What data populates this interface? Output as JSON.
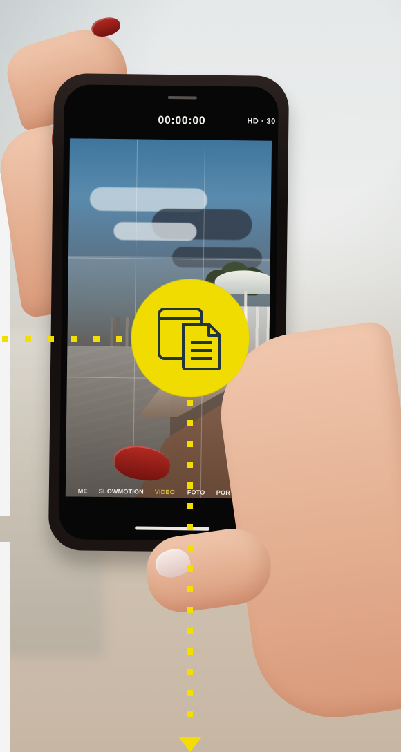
{
  "camera": {
    "timer": "00:00:00",
    "quality": "HD · 30",
    "modes": [
      "ME",
      "SLOWMOTION",
      "VIDEO",
      "FOTO",
      "PORTRET"
    ],
    "active_mode": "VIDEO"
  },
  "overlay": {
    "accent_color": "#f3de00",
    "icon": "document-window-icon"
  }
}
